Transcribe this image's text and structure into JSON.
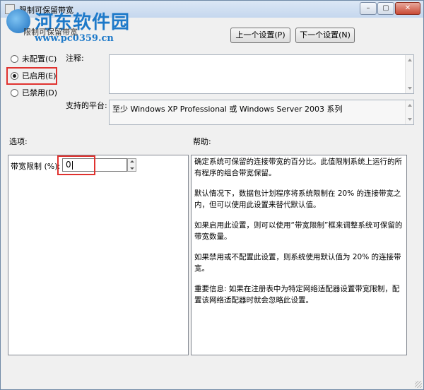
{
  "window": {
    "title": "限制可保留带宽",
    "controls": {
      "minimize": "–",
      "maximize": "▢",
      "close": "✕"
    }
  },
  "watermark": {
    "name": "河东软件园",
    "url": "www.pc0359.cn"
  },
  "header": {
    "setting_name": "限制可保留带宽",
    "prev_button": "上一个设置(P)",
    "next_button": "下一个设置(N)"
  },
  "state": {
    "options": [
      {
        "label": "未配置(C)",
        "checked": false
      },
      {
        "label": "已启用(E)",
        "checked": true
      },
      {
        "label": "已禁用(D)",
        "checked": false
      }
    ]
  },
  "comment": {
    "label": "注释:",
    "value": ""
  },
  "platform": {
    "label": "支持的平台:",
    "value": "至少 Windows XP Professional 或 Windows Server 2003 系列"
  },
  "options_section": {
    "label": "选项:",
    "bandwidth_label": "带宽限制 (%):",
    "bandwidth_value": "0"
  },
  "help_section": {
    "label": "帮助:",
    "paragraphs": [
      "确定系统可保留的连接带宽的百分比。此值限制系统上运行的所有程序的组合带宽保留。",
      "默认情况下，数据包计划程序将系统限制在 20% 的连接带宽之内，但可以使用此设置来替代默认值。",
      "如果启用此设置，则可以使用“带宽限制”框来调整系统可保留的带宽数量。",
      "如果禁用或不配置此设置，则系统使用默认值为 20% 的连接带宽。",
      "重要信息: 如果在注册表中为特定网络适配器设置带宽限制，配置该网络适配器时就会忽略此设置。"
    ]
  },
  "colors": {
    "highlight": "#e0322f",
    "watermark": "#1d79c9"
  }
}
